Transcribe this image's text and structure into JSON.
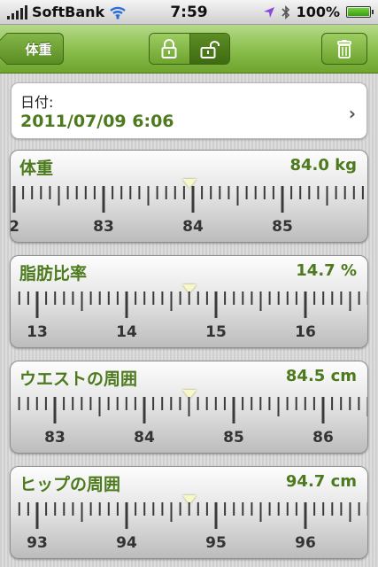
{
  "status_bar": {
    "carrier": "SoftBank",
    "time": "7:59",
    "battery": "100%",
    "battery_level": 1.0
  },
  "toolbar": {
    "back_label": "体重"
  },
  "date": {
    "label": "日付:",
    "value": "2011/07/09 6:06"
  },
  "measurements": [
    {
      "label": "体重",
      "value": "84.0 kg",
      "reading": 84.0,
      "ticks": [
        "2",
        "83",
        "84",
        "85",
        "8"
      ]
    },
    {
      "label": "脂肪比率",
      "value": "14.7 %",
      "reading": 14.7,
      "ticks": [
        "13",
        "14",
        "15",
        "16"
      ]
    },
    {
      "label": "ウエストの周囲",
      "value": "84.5 cm",
      "reading": 84.5,
      "ticks": [
        "83",
        "84",
        "85",
        "86"
      ]
    },
    {
      "label": "ヒップの周囲",
      "value": "94.7 cm",
      "reading": 94.7,
      "ticks": [
        "93",
        "94",
        "95",
        "96"
      ]
    }
  ],
  "colors": {
    "accent": "#4c7a1d",
    "toolbar": "#8cc04f"
  },
  "icons": {
    "back": "back-arrow-icon",
    "lock": "lock-icon",
    "unlock": "unlock-icon",
    "trash": "trash-icon"
  }
}
